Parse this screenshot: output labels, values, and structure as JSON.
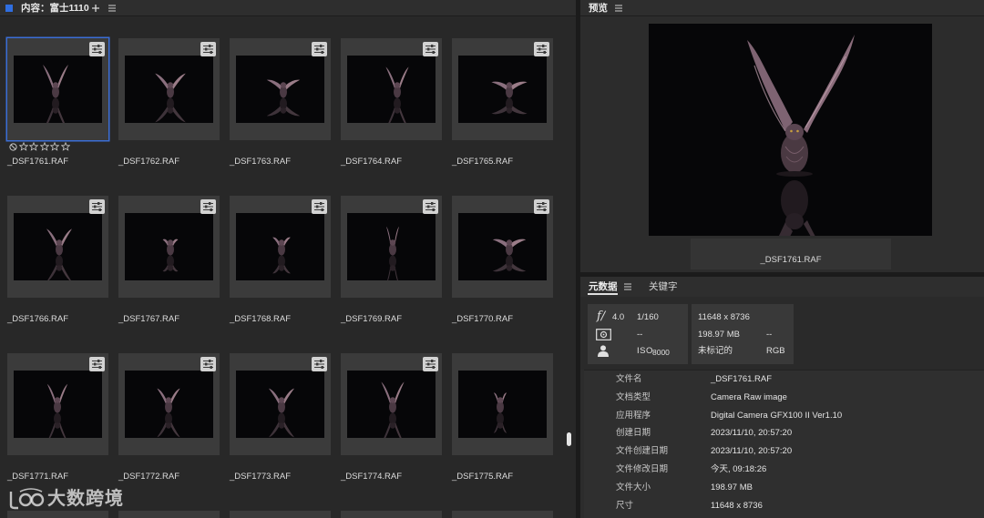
{
  "colors": {
    "selection": "#3b6ed6",
    "panel_label": "#2f6ee0"
  },
  "content_panel": {
    "title": "内容：富士1110",
    "add_icon": "plus-icon",
    "menu_icon": "menu-icon",
    "thumbnails": [
      {
        "filename": "_DSF1761.RAF",
        "selected": true,
        "adjusted": true,
        "rating": 0
      },
      {
        "filename": "_DSF1762.RAF",
        "selected": false,
        "adjusted": true
      },
      {
        "filename": "_DSF1763.RAF",
        "selected": false,
        "adjusted": true
      },
      {
        "filename": "_DSF1764.RAF",
        "selected": false,
        "adjusted": true
      },
      {
        "filename": "_DSF1765.RAF",
        "selected": false,
        "adjusted": true
      },
      {
        "filename": "_DSF1766.RAF",
        "selected": false,
        "adjusted": true
      },
      {
        "filename": "_DSF1767.RAF",
        "selected": false,
        "adjusted": true
      },
      {
        "filename": "_DSF1768.RAF",
        "selected": false,
        "adjusted": true
      },
      {
        "filename": "_DSF1769.RAF",
        "selected": false,
        "adjusted": true
      },
      {
        "filename": "_DSF1770.RAF",
        "selected": false,
        "adjusted": true
      },
      {
        "filename": "_DSF1771.RAF",
        "selected": false,
        "adjusted": true
      },
      {
        "filename": "_DSF1772.RAF",
        "selected": false,
        "adjusted": true
      },
      {
        "filename": "_DSF1773.RAF",
        "selected": false,
        "adjusted": true
      },
      {
        "filename": "_DSF1774.RAF",
        "selected": false,
        "adjusted": true
      },
      {
        "filename": "_DSF1775.RAF",
        "selected": false,
        "adjusted": false
      }
    ]
  },
  "preview_panel": {
    "title": "预览",
    "menu_icon": "menu-icon",
    "filename": "_DSF1761.RAF"
  },
  "metadata_panel": {
    "tabs": [
      {
        "label": "元数据",
        "active": true
      },
      {
        "label": "关键字",
        "active": false
      }
    ],
    "placard": {
      "aperture_symbol": "f/",
      "aperture": "4.0",
      "shutter": "1/160",
      "metering": "--",
      "iso_label": "ISO",
      "iso": "8000",
      "dimensions": "11648 x 8736",
      "file_size": "198.97 MB",
      "color_profile": "--",
      "label": "未标记的",
      "color_mode": "RGB"
    },
    "properties": [
      {
        "label": "文件名",
        "value": "_DSF1761.RAF"
      },
      {
        "label": "文档类型",
        "value": "Camera Raw image"
      },
      {
        "label": "应用程序",
        "value": "Digital Camera GFX100 II Ver1.10"
      },
      {
        "label": "创建日期",
        "value": "2023/11/10, 20:57:20"
      },
      {
        "label": "文件创建日期",
        "value": "2023/11/10, 20:57:20"
      },
      {
        "label": "文件修改日期",
        "value": "今天, 09:18:26"
      },
      {
        "label": "文件大小",
        "value": "198.97 MB"
      },
      {
        "label": "尺寸",
        "value": "11648 x 8736"
      }
    ]
  },
  "watermark": {
    "text": "大数跨境",
    "logo_icon": "brand-logo-icon"
  }
}
